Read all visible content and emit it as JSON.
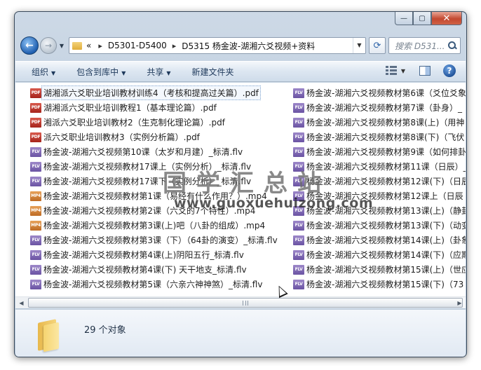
{
  "window": {
    "minimize_glyph": "—",
    "maximize_glyph": "▢",
    "close_glyph": "✕"
  },
  "address_bar": {
    "overflow_glyph": "«",
    "crumbs": [
      "D5301-D5400",
      "D5315 杨金波-湖湘六爻视频+资料"
    ],
    "separator": "▸",
    "search_placeholder": "搜索 D531..."
  },
  "commands": {
    "organize": "组织",
    "include_in_library": "包含到库中",
    "share": "共享",
    "new_folder": "新建文件夹"
  },
  "files_left": [
    {
      "type": "pdf",
      "name": "湖湘派六爻职业培训教材训练4（考核和提高过关篇）.pdf",
      "selected": true
    },
    {
      "type": "pdf",
      "name": "湖湘派六爻职业培训教程1（基本理论篇）.pdf"
    },
    {
      "type": "pdf",
      "name": "湘派六爻职业培训教材2（生克制化理论篇）.pdf"
    },
    {
      "type": "pdf",
      "name": "派六爻职业培训教材3（实例分析篇）.pdf"
    },
    {
      "type": "flv",
      "name": "杨金波-湖湘六爻视频第10课（太岁和月建）_标清.flv"
    },
    {
      "type": "flv",
      "name": "杨金波-湖湘六爻视频教材17课上（实例分析）_标清.flv"
    },
    {
      "type": "flv",
      "name": "杨金波-湖湘六爻视频教材17课下（实例分析）_标清.flv"
    },
    {
      "type": "mp4",
      "name": "杨金波-湖湘六爻视频教材第1课（易经有什么作用？）.mp4"
    },
    {
      "type": "mp4",
      "name": "杨金波-湖湘六爻视频教材第2课（六爻的7个特性）.mp4"
    },
    {
      "type": "mp4",
      "name": "杨金波-湖湘六爻视频教材第3课(上)吧（八卦的组成）.mp4"
    },
    {
      "type": "flv",
      "name": "杨金波-湖湘六爻视频教材第3课（下）（64卦的演变）_标清.flv"
    },
    {
      "type": "flv",
      "name": "杨金波-湖湘六爻视频教材第4课(上)阴阳五行_标清.flv"
    },
    {
      "type": "flv",
      "name": "杨金波-湖湘六爻视频教材第4课(下) 天干地支_标清.flv"
    },
    {
      "type": "flv",
      "name": "杨金波-湖湘六爻视频教材第5课（六亲六神神煞）_标清.flv"
    }
  ],
  "files_right": [
    {
      "type": "flv",
      "name": "杨金波-湖湘六爻视频教材第6课（爻位爻象"
    },
    {
      "type": "flv",
      "name": "杨金波-湖湘六爻视频教材第7课（卦身）_"
    },
    {
      "type": "flv",
      "name": "杨金波-湖湘六爻视频教材第8课(上)（用神"
    },
    {
      "type": "flv",
      "name": "杨金波-湖湘六爻视频教材第8课(下)（飞伏"
    },
    {
      "type": "flv",
      "name": "杨金波-湖湘六爻视频教材第9课（如何排卦"
    },
    {
      "type": "flv",
      "name": "杨金波-湖湘六爻视频教材第11课（日辰）_"
    },
    {
      "type": "flv",
      "name": "杨金波-湖湘六爻视频教材第12课(下)（日辰"
    },
    {
      "type": "flv",
      "name": "杨金波-湖湘六爻视频教材第12课上（日辰"
    },
    {
      "type": "flv",
      "name": "杨金波-湖湘六爻视频教材第13课(上)（静卦"
    },
    {
      "type": "flv",
      "name": "杨金波-湖湘六爻视频教材第13课(下)（动变"
    },
    {
      "type": "flv",
      "name": "杨金波-湖湘六爻视频教材第14课(上)（卦象"
    },
    {
      "type": "flv",
      "name": "杨金波-湖湘六爻视频教材第14课(下)（应期"
    },
    {
      "type": "flv",
      "name": "杨金波-湖湘六爻视频教材第15课(上)（世应"
    },
    {
      "type": "flv",
      "name": "杨金波-湖湘六爻视频教材第15课(下)（73"
    }
  ],
  "icon_labels": {
    "pdf": "PDF",
    "flv": "FLV",
    "mp4": "MP4"
  },
  "watermark": {
    "text": "国学汇总站",
    "url": "www.guoxuehuizong.com"
  },
  "status": {
    "object_count": "29 个对象"
  },
  "colors": {
    "accent": "#1e395b",
    "selection_border": "#7da2ce"
  }
}
